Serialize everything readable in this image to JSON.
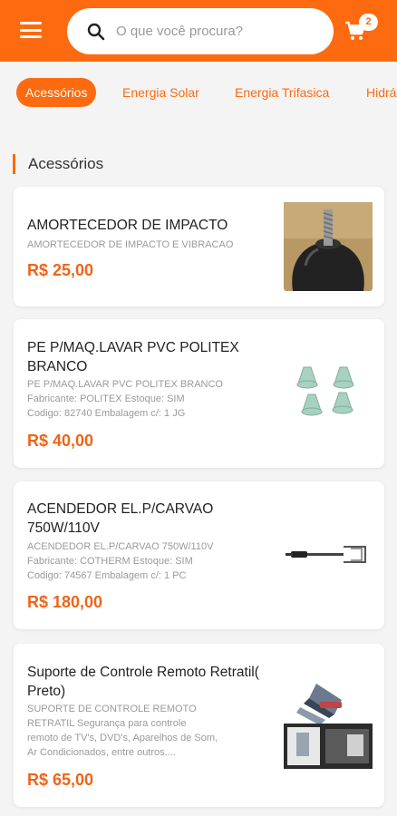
{
  "header": {
    "search_placeholder": "O que você procura?",
    "cart_count": "2",
    "brand_color": "#fd6a0f"
  },
  "categories": [
    {
      "label": "Acessórios",
      "active": true
    },
    {
      "label": "Energia Solar",
      "active": false
    },
    {
      "label": "Energia Trifasica",
      "active": false
    },
    {
      "label": "Hidrá",
      "active": false
    }
  ],
  "section": {
    "title": "Acessórios"
  },
  "products": [
    {
      "name": "AMORTECEDOR DE IMPACTO",
      "description": [
        "AMORTECEDOR DE IMPACTO E VIBRACAO"
      ],
      "price": "R$ 25,00",
      "image": "rubber-shock-absorber"
    },
    {
      "name": "PE P/MAQ.LAVAR PVC POLITEX BRANCO",
      "description": [
        "PE P/MAQ.LAVAR PVC POLITEX BRANCO",
        "Fabricante: POLITEX Estoque: SIM",
        "Codigo: 82740 Embalagem c/: 1 JG"
      ],
      "price": "R$ 40,00",
      "image": "washing-machine-feet"
    },
    {
      "name": "ACENDEDOR EL.P/CARVAO 750W/110V",
      "description": [
        "ACENDEDOR EL.P/CARVAO 750W/110V",
        "Fabricante: COTHERM Estoque: SIM",
        "Codigo: 74567 Embalagem c/: 1 PC"
      ],
      "price": "R$ 180,00",
      "image": "charcoal-lighter"
    },
    {
      "name": "Suporte de Controle Remoto Retratil( Preto)",
      "description": [
        "SUPORTE DE CONTROLE REMOTO",
        "RETRATIL Segurança para controle",
        "remoto de TV's, DVD's, Aparelhos de Som,",
        "Ar Condicionados, entre outros...."
      ],
      "price": "R$ 65,00",
      "image": "remote-holder"
    }
  ]
}
